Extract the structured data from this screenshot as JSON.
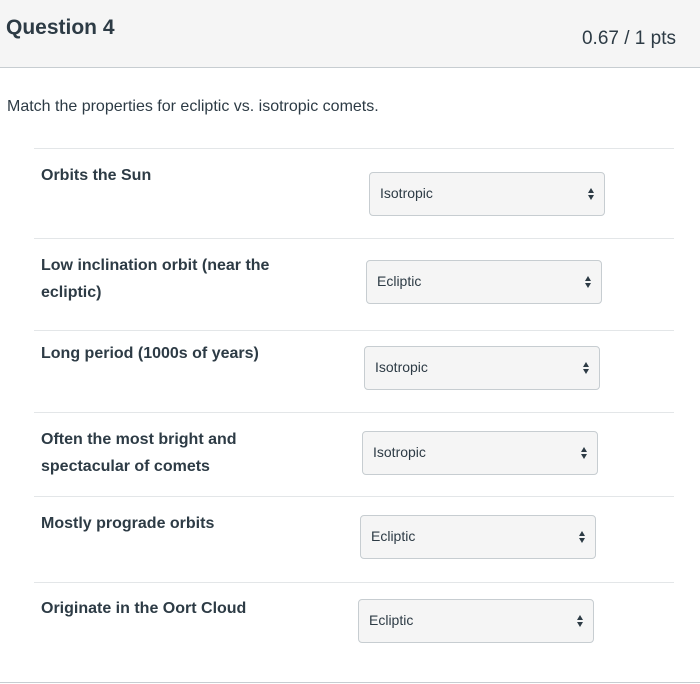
{
  "question": {
    "title": "Question 4",
    "points": "0.67 / 1 pts",
    "text": "Match the properties for ecliptic vs. isotropic comets."
  },
  "matches": [
    {
      "label": "Orbits the Sun",
      "selected": "Isotropic"
    },
    {
      "label": "Low inclination orbit (near the ecliptic)",
      "selected": "Ecliptic"
    },
    {
      "label": "Long period (1000s of years)",
      "selected": "Isotropic"
    },
    {
      "label": "Often the most bright and spectacular of comets",
      "selected": "Isotropic"
    },
    {
      "label": "Mostly prograde orbits",
      "selected": "Ecliptic"
    },
    {
      "label": "Originate in the Oort Cloud",
      "selected": "Ecliptic"
    }
  ],
  "icons": {
    "select_arrow": "up-down-chevron-icon"
  }
}
